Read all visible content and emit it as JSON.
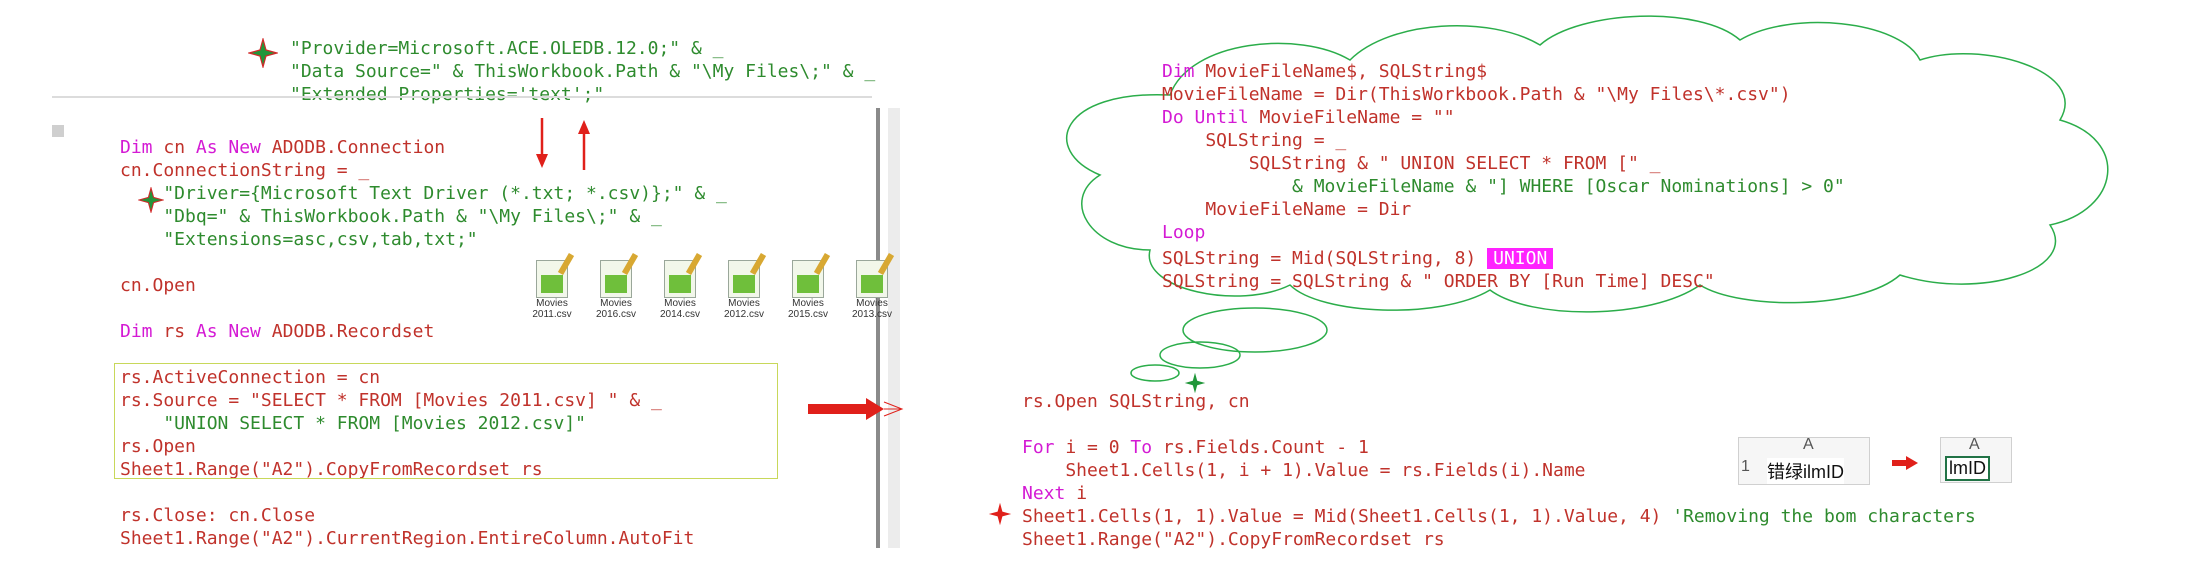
{
  "colors": {
    "keyword": "#d41ad4",
    "string": "#2e8b2e",
    "plain": "#c0322b",
    "highlight": "#ff22ff",
    "arrow": "#e0201a",
    "box": "#c8d85a"
  },
  "top_snippet": [
    "\"Provider=Microsoft.ACE.OLEDB.12.0;\" & _",
    "\"Data Source=\" & ThisWorkbook.Path & \"\\My Files\\;\" & _",
    "\"Extended Properties='text';\""
  ],
  "left_code": {
    "line1_kw1": "Dim",
    "line1_a": " cn ",
    "line1_kw2": "As New",
    "line1_b": " ADODB.Connection",
    "line2": "cn.ConnectionString = _",
    "line3": "    \"Driver={Microsoft Text Driver (*.txt; *.csv)};\" & _",
    "line4": "    \"Dbq=\" & ThisWorkbook.Path & \"\\My Files\\;\" & _",
    "line5": "    \"Extensions=asc,csv,tab,txt;\"",
    "line6": "cn.Open",
    "line7_kw1": "Dim",
    "line7_a": " rs ",
    "line7_kw2": "As New",
    "line7_b": " ADODB.Recordset",
    "line8": "rs.ActiveConnection = cn",
    "line9": "rs.Source = \"SELECT * FROM [Movies 2011.csv] \" & _",
    "line10": "    \"UNION SELECT * FROM [Movies 2012.csv]\"",
    "line11": "rs.Open",
    "line12": "Sheet1.Range(\"A2\").CopyFromRecordset rs",
    "line13": "rs.Close: cn.Close",
    "line14": "Sheet1.Range(\"A2\").CurrentRegion.EntireColumn.AutoFit"
  },
  "files": [
    "Movies 2011.csv",
    "Movies 2016.csv",
    "Movies 2014.csv",
    "Movies 2012.csv",
    "Movies 2015.csv",
    "Movies 2013.csv"
  ],
  "cloud_code": {
    "l1_kw": "Dim",
    "l1": " MovieFileName$, SQLString$",
    "l2": "MovieFileName = Dir(ThisWorkbook.Path & \"\\My Files\\*.csv\")",
    "l3_kw": "Do Until",
    "l3": " MovieFileName = \"\"",
    "l4": "    SQLString = _",
    "l5": "        SQLString & \" UNION SELECT * FROM [\" _",
    "l6": "            & MovieFileName & \"] WHERE [Oscar Nominations] > 0\"",
    "l7": "    MovieFileName = Dir",
    "l8_kw": "Loop",
    "l9": "SQLString = Mid(SQLString, 8)",
    "l9_hl": "UNION",
    "l10": "SQLString = SQLString & \" ORDER BY [Run Time] DESC\""
  },
  "right_code": {
    "r1": "rs.Open SQLString, cn",
    "r2_kw1": "For",
    "r2_a": " i = 0 ",
    "r2_kw2": "To",
    "r2_b": " rs.Fields.Count - 1",
    "r3": "    Sheet1.Cells(1, i + 1).Value = rs.Fields(i).Name",
    "r4_kw": "Next",
    "r4": " i",
    "r5": "Sheet1.Cells(1, 1).Value = Mid(Sheet1.Cells(1, 1).Value, 4)",
    "r5_comment": " 'Removing the bom characters",
    "r6": "Sheet1.Range(\"A2\").CopyFromRecordset rs"
  },
  "excel_before": {
    "col": "A",
    "row": "1",
    "value": "错绿ilmID"
  },
  "excel_after": {
    "col": "A",
    "value": "lmID"
  }
}
